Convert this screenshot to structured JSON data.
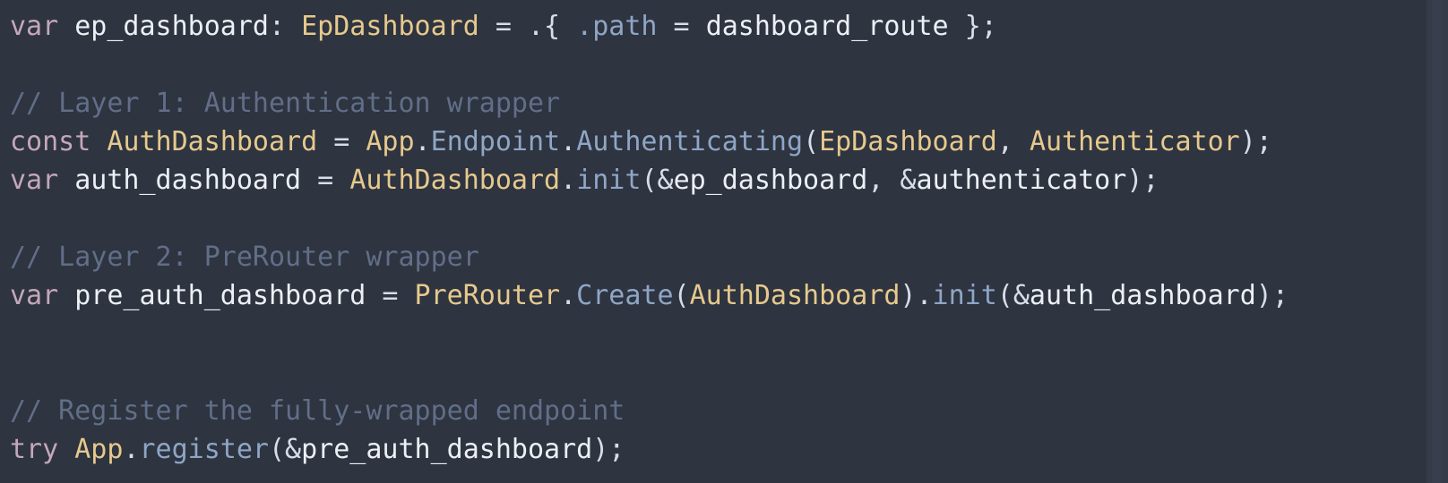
{
  "editor": {
    "colors": {
      "background": "#2e3440",
      "keyword": "#c4a7b9",
      "type": "#e6c98d",
      "function": "#8fa6c6",
      "comment": "#616e88",
      "identifier": "#eceff4"
    },
    "lines": {
      "l1": {
        "kw": "var",
        "name": " ep_dashboard",
        "colon": ": ",
        "type": "EpDashboard",
        "eq": " = .{ ",
        "field": ".path",
        "eq2": " = ",
        "value": "dashboard_route",
        "end": " };"
      },
      "l3": {
        "comment": "// Layer 1: Authentication wrapper"
      },
      "l4": {
        "kw": "const",
        "name": " AuthDashboard",
        "eq": " = ",
        "app": "App",
        "dot1": ".",
        "endpoint": "Endpoint",
        "dot2": ".",
        "fn": "Authenticating",
        "open": "(",
        "arg1": "EpDashboard",
        "comma": ", ",
        "arg2": "Authenticator",
        "close": ");"
      },
      "l5": {
        "kw": "var",
        "name": " auth_dashboard",
        "eq": " = ",
        "type": "AuthDashboard",
        "dot": ".",
        "fn": "init",
        "open": "(&",
        "arg1": "ep_dashboard",
        "comma": ", &",
        "arg2": "authenticator",
        "close": ");"
      },
      "l7": {
        "comment": "// Layer 2: PreRouter wrapper"
      },
      "l8": {
        "kw": "var",
        "name": " pre_auth_dashboard",
        "eq": " = ",
        "type": "PreRouter",
        "dot1": ".",
        "fn1": "Create",
        "open1": "(",
        "arg": "AuthDashboard",
        "close1": ")",
        "dot2": ".",
        "fn2": "init",
        "open2": "(&",
        "arg2": "auth_dashboard",
        "close2": ");"
      },
      "l11": {
        "comment": "// Register the fully-wrapped endpoint"
      },
      "l12": {
        "kw": "try",
        "sp": " ",
        "app": "App",
        "dot": ".",
        "fn": "register",
        "open": "(&",
        "arg": "pre_auth_dashboard",
        "close": ");"
      }
    }
  }
}
